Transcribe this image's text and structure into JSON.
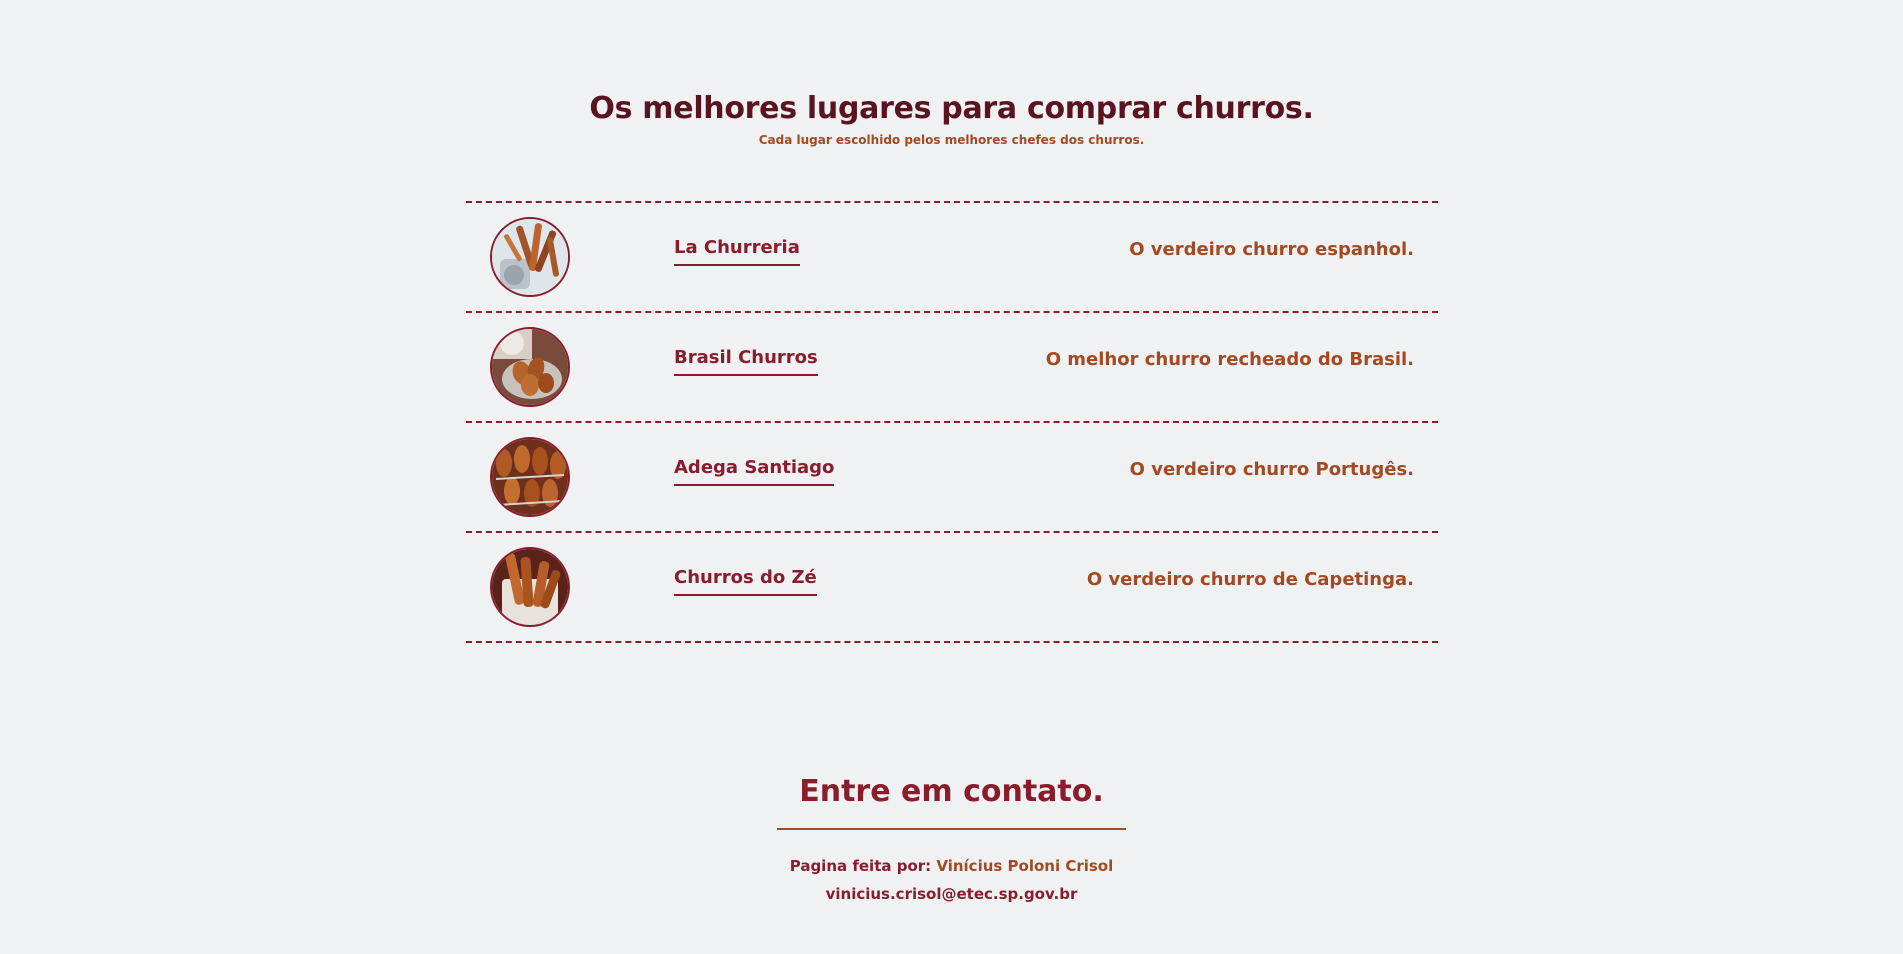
{
  "header": {
    "title": "Os melhores lugares para comprar churros.",
    "subtitle": "Cada lugar escolhido pelos melhores chefes dos churros."
  },
  "places": [
    {
      "name": "La Churreria",
      "description": "O verdeiro churro espanhol.",
      "image": "churros-photo-1"
    },
    {
      "name": "Brasil Churros",
      "description": "O melhor churro recheado do Brasil.",
      "image": "churros-photo-2"
    },
    {
      "name": "Adega Santiago",
      "description": "O verdeiro churro Portugês.",
      "image": "churros-photo-3"
    },
    {
      "name": "Churros do Zé",
      "description": "O verdeiro churro de Capetinga.",
      "image": "churros-photo-4"
    }
  ],
  "contact": {
    "title": "Entre em contato.",
    "credit_label": "Pagina feita por: ",
    "author": "Vinícius Poloni Crisol",
    "email": "vinicius.crisol@etec.sp.gov.br"
  },
  "colors": {
    "background": "#f0f1f3",
    "primary": "#8a1d2c",
    "title": "#5a1420",
    "accent": "#a34a22"
  }
}
